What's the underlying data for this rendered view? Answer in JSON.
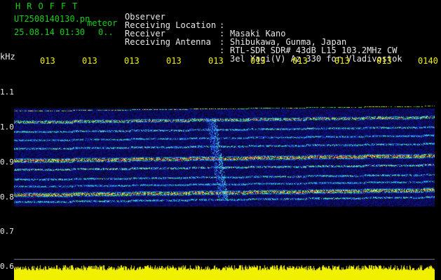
{
  "brand": "HROFFT",
  "file": {
    "name": "UT2508140130.pn",
    "datetime": "25.08.14 01:30",
    "tag": "meteor",
    "tag2": "0.."
  },
  "header": [
    {
      "label": "Observer",
      "value": "Masaki Kano"
    },
    {
      "label": "Receiving Location",
      "value": "Shibukawa, Gunma, Japan"
    },
    {
      "label": "Receiver",
      "value": "RTL-SDR SDR# 43dB L15 103.2MHz CW"
    },
    {
      "label": "Receiving Antenna",
      "value": "3el Yagi(V) Az 330 for Vladivostok"
    }
  ],
  "axis": {
    "y_unit": "kHz",
    "y_ticks": [
      "1.1",
      "1.0",
      "0.9",
      "0.8",
      "0.7",
      "0.6"
    ],
    "x_ticks": [
      "013",
      "013",
      "013",
      "013",
      "013",
      "013",
      "013",
      "013",
      "013",
      "0140"
    ]
  },
  "colors": {
    "label_green": "#17d117",
    "text": "#e8e8e8",
    "axis_yellow": "#f0f000",
    "background": "#000000",
    "noise_floor": "#0a0a8a"
  }
}
